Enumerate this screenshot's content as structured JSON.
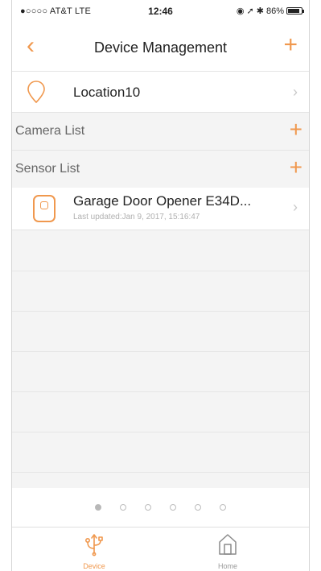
{
  "status_bar": {
    "carrier": "●○○○○ AT&T  LTE",
    "time": "12:46",
    "indicators": "◉ ➚ ✱",
    "battery_percent": "86%",
    "battery_level": 0.86
  },
  "navbar": {
    "back_icon": "chevron-left-icon",
    "title": "Device Management",
    "add_icon": "plus-icon"
  },
  "location": {
    "name": "Location10",
    "icon": "location-pin-icon"
  },
  "sections": {
    "camera_list": "Camera List",
    "sensor_list": "Sensor List"
  },
  "sensors": [
    {
      "name": "Garage Door Opener E34D...",
      "last_updated": "Last updated:Jan 9, 2017, 15:16:47",
      "icon": "garage-sensor-icon"
    }
  ],
  "page_dots": {
    "count": 6,
    "active_index": 0
  },
  "tabs": [
    {
      "label": "Device",
      "icon": "device-usb-icon",
      "active": true
    },
    {
      "label": "Home",
      "icon": "home-icon",
      "active": false
    }
  ],
  "colors": {
    "accent": "#f0984e",
    "section_bg": "#f4f4f4",
    "divider": "#e4e4e4",
    "inactive_tab": "#9a9a9a"
  }
}
